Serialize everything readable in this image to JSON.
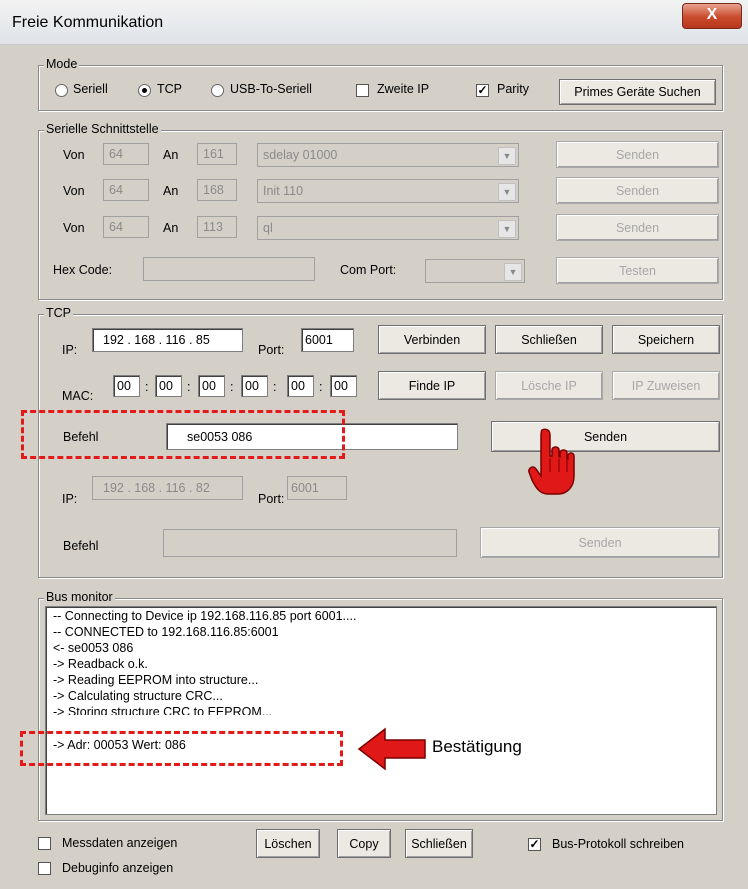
{
  "window": {
    "title": "Freie Kommunikation",
    "close_glyph": "X"
  },
  "mode": {
    "label": "Mode",
    "radios": [
      {
        "label": "Seriell",
        "selected": false
      },
      {
        "label": "TCP",
        "selected": true
      },
      {
        "label": "USB-To-Seriell",
        "selected": false
      }
    ],
    "zweite_ip": {
      "label": "Zweite IP",
      "checked": false
    },
    "parity": {
      "label": "Parity",
      "checked": true
    },
    "search_button": "Primes Geräte Suchen"
  },
  "serial": {
    "label": "Serielle Schnittstelle",
    "rows": [
      {
        "von_label": "Von",
        "von": "64",
        "an_label": "An",
        "an": "161",
        "command": "sdelay 01000",
        "send": "Senden"
      },
      {
        "von_label": "Von",
        "von": "64",
        "an_label": "An",
        "an": "168",
        "command": "Init 110",
        "send": "Senden"
      },
      {
        "von_label": "Von",
        "von": "64",
        "an_label": "An",
        "an": "113",
        "command": "ql",
        "send": "Senden"
      }
    ],
    "hex_label": "Hex Code:",
    "hex_value": "",
    "com_label": "Com Port:",
    "com_value": "",
    "test_button": "Testen"
  },
  "tcp": {
    "label": "TCP",
    "ip_label": "IP:",
    "ip": "192 . 168 . 116 . 85",
    "port_label": "Port:",
    "port": "6001",
    "connect": "Verbinden",
    "close": "Schließen",
    "save": "Speichern",
    "mac_label": "MAC:",
    "mac": [
      "00",
      "00",
      "00",
      "00",
      "00",
      "00"
    ],
    "mac_sep": ":",
    "find_ip": "Finde IP",
    "delete_ip": "Lösche IP",
    "assign_ip": "IP Zuweisen",
    "befehl_label": "Befehl",
    "befehl": "se0053 086",
    "send": "Senden",
    "ip2": "192 . 168 . 116 . 82",
    "port2": "6001",
    "befehl2": "",
    "send2": "Senden"
  },
  "bus": {
    "label": "Bus monitor",
    "lines": [
      "-- Connecting to Device ip 192.168.116.85 port 6001....",
      "-- CONNECTED to 192.168.116.85:6001",
      "<- se0053 086",
      "-> Readback o.k.",
      "-> Reading EEPROM into structure...",
      "-> Calculating structure CRC...",
      "-> Storing structure CRC to EEPROM...",
      "-> Adr: 00053 Wert: 086"
    ],
    "annotation": "Bestätigung"
  },
  "bottom": {
    "messdaten": {
      "label": "Messdaten anzeigen",
      "checked": false
    },
    "debug": {
      "label": "Debuginfo anzeigen",
      "checked": false
    },
    "clear": "Löschen",
    "copy": "Copy",
    "close": "Schließen",
    "protocol": {
      "label": "Bus-Protokoll schreiben",
      "checked": true
    }
  },
  "colors": {
    "annotation_red": "#e21a1a",
    "window_bg": "#d4d0c8"
  },
  "icons": {
    "pointer": "hand-pointer-icon",
    "arrow": "left-arrow-icon"
  }
}
